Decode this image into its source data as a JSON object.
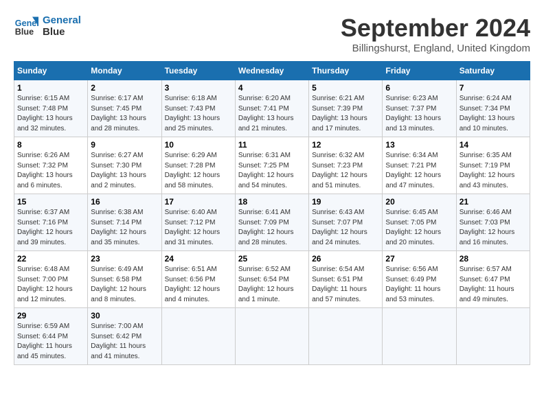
{
  "logo": {
    "line1": "General",
    "line2": "Blue"
  },
  "title": "September 2024",
  "location": "Billingshurst, England, United Kingdom",
  "headers": [
    "Sunday",
    "Monday",
    "Tuesday",
    "Wednesday",
    "Thursday",
    "Friday",
    "Saturday"
  ],
  "weeks": [
    [
      {
        "day": "1",
        "info": "Sunrise: 6:15 AM\nSunset: 7:48 PM\nDaylight: 13 hours\nand 32 minutes."
      },
      {
        "day": "2",
        "info": "Sunrise: 6:17 AM\nSunset: 7:45 PM\nDaylight: 13 hours\nand 28 minutes."
      },
      {
        "day": "3",
        "info": "Sunrise: 6:18 AM\nSunset: 7:43 PM\nDaylight: 13 hours\nand 25 minutes."
      },
      {
        "day": "4",
        "info": "Sunrise: 6:20 AM\nSunset: 7:41 PM\nDaylight: 13 hours\nand 21 minutes."
      },
      {
        "day": "5",
        "info": "Sunrise: 6:21 AM\nSunset: 7:39 PM\nDaylight: 13 hours\nand 17 minutes."
      },
      {
        "day": "6",
        "info": "Sunrise: 6:23 AM\nSunset: 7:37 PM\nDaylight: 13 hours\nand 13 minutes."
      },
      {
        "day": "7",
        "info": "Sunrise: 6:24 AM\nSunset: 7:34 PM\nDaylight: 13 hours\nand 10 minutes."
      }
    ],
    [
      {
        "day": "8",
        "info": "Sunrise: 6:26 AM\nSunset: 7:32 PM\nDaylight: 13 hours\nand 6 minutes."
      },
      {
        "day": "9",
        "info": "Sunrise: 6:27 AM\nSunset: 7:30 PM\nDaylight: 13 hours\nand 2 minutes."
      },
      {
        "day": "10",
        "info": "Sunrise: 6:29 AM\nSunset: 7:28 PM\nDaylight: 12 hours\nand 58 minutes."
      },
      {
        "day": "11",
        "info": "Sunrise: 6:31 AM\nSunset: 7:25 PM\nDaylight: 12 hours\nand 54 minutes."
      },
      {
        "day": "12",
        "info": "Sunrise: 6:32 AM\nSunset: 7:23 PM\nDaylight: 12 hours\nand 51 minutes."
      },
      {
        "day": "13",
        "info": "Sunrise: 6:34 AM\nSunset: 7:21 PM\nDaylight: 12 hours\nand 47 minutes."
      },
      {
        "day": "14",
        "info": "Sunrise: 6:35 AM\nSunset: 7:19 PM\nDaylight: 12 hours\nand 43 minutes."
      }
    ],
    [
      {
        "day": "15",
        "info": "Sunrise: 6:37 AM\nSunset: 7:16 PM\nDaylight: 12 hours\nand 39 minutes."
      },
      {
        "day": "16",
        "info": "Sunrise: 6:38 AM\nSunset: 7:14 PM\nDaylight: 12 hours\nand 35 minutes."
      },
      {
        "day": "17",
        "info": "Sunrise: 6:40 AM\nSunset: 7:12 PM\nDaylight: 12 hours\nand 31 minutes."
      },
      {
        "day": "18",
        "info": "Sunrise: 6:41 AM\nSunset: 7:09 PM\nDaylight: 12 hours\nand 28 minutes."
      },
      {
        "day": "19",
        "info": "Sunrise: 6:43 AM\nSunset: 7:07 PM\nDaylight: 12 hours\nand 24 minutes."
      },
      {
        "day": "20",
        "info": "Sunrise: 6:45 AM\nSunset: 7:05 PM\nDaylight: 12 hours\nand 20 minutes."
      },
      {
        "day": "21",
        "info": "Sunrise: 6:46 AM\nSunset: 7:03 PM\nDaylight: 12 hours\nand 16 minutes."
      }
    ],
    [
      {
        "day": "22",
        "info": "Sunrise: 6:48 AM\nSunset: 7:00 PM\nDaylight: 12 hours\nand 12 minutes."
      },
      {
        "day": "23",
        "info": "Sunrise: 6:49 AM\nSunset: 6:58 PM\nDaylight: 12 hours\nand 8 minutes."
      },
      {
        "day": "24",
        "info": "Sunrise: 6:51 AM\nSunset: 6:56 PM\nDaylight: 12 hours\nand 4 minutes."
      },
      {
        "day": "25",
        "info": "Sunrise: 6:52 AM\nSunset: 6:54 PM\nDaylight: 12 hours\nand 1 minute."
      },
      {
        "day": "26",
        "info": "Sunrise: 6:54 AM\nSunset: 6:51 PM\nDaylight: 11 hours\nand 57 minutes."
      },
      {
        "day": "27",
        "info": "Sunrise: 6:56 AM\nSunset: 6:49 PM\nDaylight: 11 hours\nand 53 minutes."
      },
      {
        "day": "28",
        "info": "Sunrise: 6:57 AM\nSunset: 6:47 PM\nDaylight: 11 hours\nand 49 minutes."
      }
    ],
    [
      {
        "day": "29",
        "info": "Sunrise: 6:59 AM\nSunset: 6:44 PM\nDaylight: 11 hours\nand 45 minutes."
      },
      {
        "day": "30",
        "info": "Sunrise: 7:00 AM\nSunset: 6:42 PM\nDaylight: 11 hours\nand 41 minutes."
      },
      {
        "day": "",
        "info": ""
      },
      {
        "day": "",
        "info": ""
      },
      {
        "day": "",
        "info": ""
      },
      {
        "day": "",
        "info": ""
      },
      {
        "day": "",
        "info": ""
      }
    ]
  ]
}
